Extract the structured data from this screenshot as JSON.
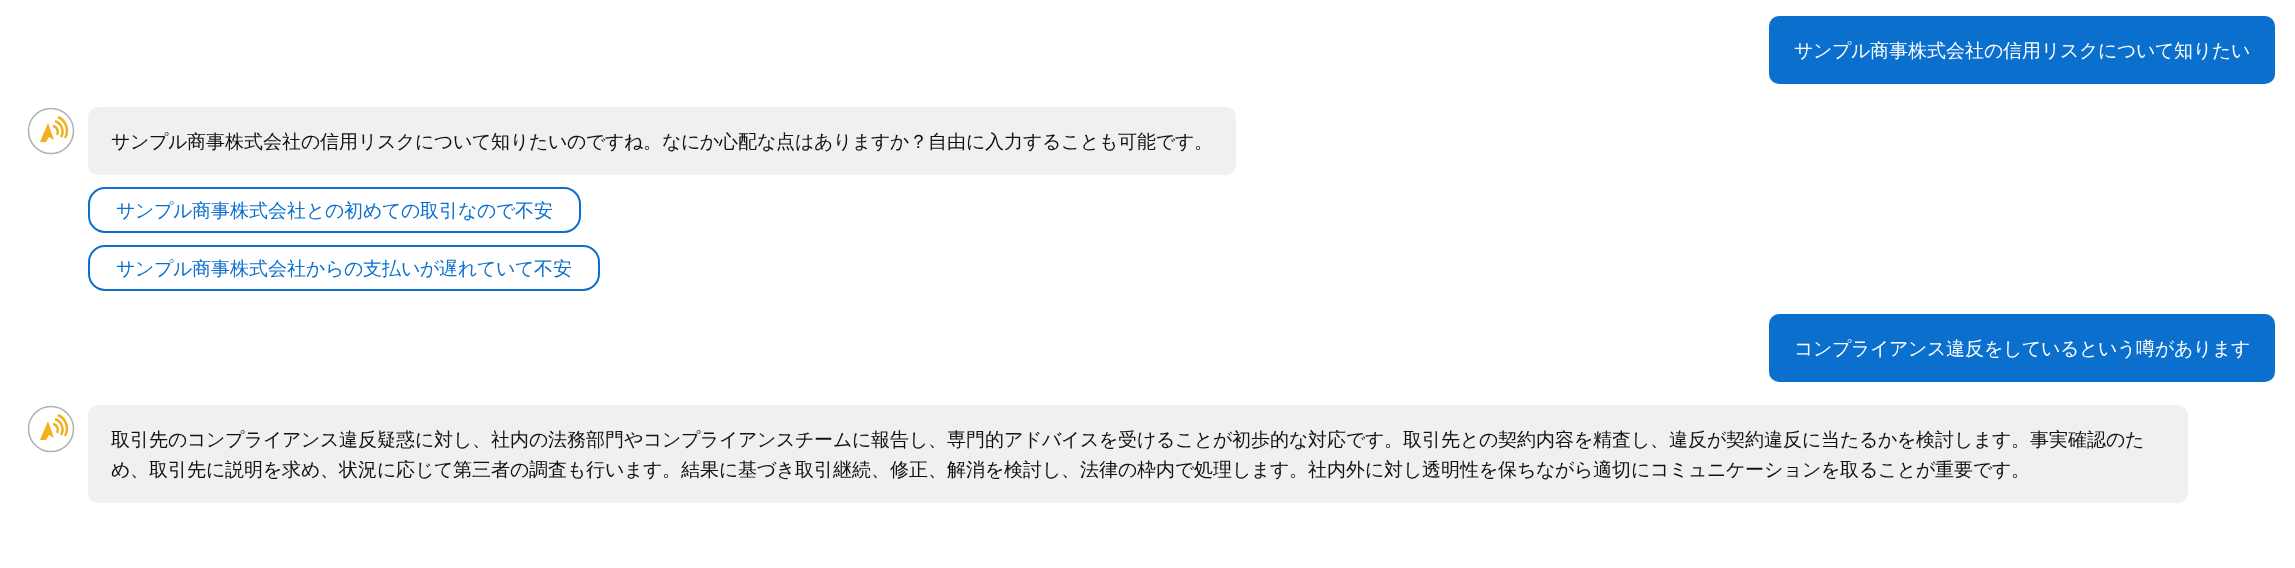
{
  "messages": [
    {
      "kind": "user",
      "text": "サンプル商事株式会社の信用リスクについて知りたい"
    },
    {
      "kind": "bot",
      "text": "サンプル商事株式会社の信用リスクについて知りたいのですね。なにか心配な点はありますか？自由に入力することも可能です。",
      "suggestions": [
        "サンプル商事株式会社との初めての取引なので不安",
        "サンプル商事株式会社からの支払いが遅れていて不安"
      ]
    },
    {
      "kind": "user",
      "text": "コンプライアンス違反をしているという噂があります"
    },
    {
      "kind": "bot",
      "text": "取引先のコンプライアンス違反疑惑に対し、社内の法務部門やコンプライアンスチームに報告し、専門的アドバイスを受けることが初歩的な対応です。取引先との契約内容を精査し、違反が契約違反に当たるかを検討します。事実確認のため、取引先に説明を求め、状況に応じて第三者の調査も行います。結果に基づき取引継続、修正、解消を検討し、法律の枠内で処理します。社内外に対し透明性を保ちながら適切にコミュニケーションを取ることが重要です。"
    }
  ]
}
